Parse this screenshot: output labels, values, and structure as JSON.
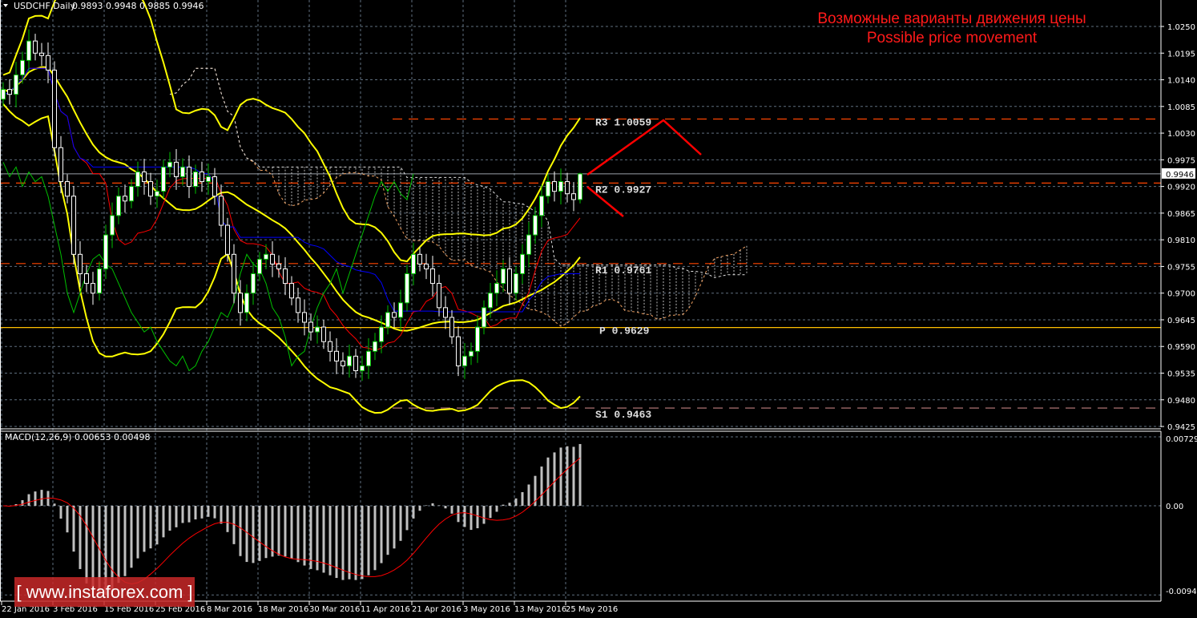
{
  "header": {
    "symbol": "USDCHF,Daily",
    "ohlc": "0.9893 0.9948 0.9885 0.9946"
  },
  "annotation": {
    "line1": "Возможные варианты движения цены",
    "line2": "Possible price movement"
  },
  "watermark": "[ www.instaforex.com ]",
  "colors": {
    "bull_border": "#00c000",
    "bear_border": "#ffffff",
    "bollinger": "#ffff00",
    "tenkan": "#ff0000",
    "kijun": "#0000ff",
    "chikou": "#00c000",
    "grid": "#5f6f7f",
    "arrow": "#ff0000"
  },
  "chart_data": [
    {
      "type": "candlestick",
      "title": "USDCHF,Daily",
      "ylim": [
        0.94,
        1.029
      ],
      "y_ticks": [
        "1.0250",
        "1.0195",
        "1.0140",
        "1.0085",
        "1.0030",
        "0.9975",
        "0.9920",
        "0.9865",
        "0.9810",
        "0.9755",
        "0.9700",
        "0.9645",
        "0.9590",
        "0.9535",
        "0.9480",
        "0.9425"
      ],
      "current_price": "0.9946",
      "x_ticks": [
        {
          "label": "22 Jan 2016",
          "bar": 0
        },
        {
          "label": "3 Feb 2016",
          "bar": 8
        },
        {
          "label": "15 Feb 2016",
          "bar": 16
        },
        {
          "label": "25 Feb 2016",
          "bar": 24
        },
        {
          "label": "8 Mar 2016",
          "bar": 32
        },
        {
          "label": "18 Mar 2016",
          "bar": 40
        },
        {
          "label": "30 Mar 2016",
          "bar": 48
        },
        {
          "label": "11 Apr 2016",
          "bar": 56
        },
        {
          "label": "21 Apr 2016",
          "bar": 64
        },
        {
          "label": "3 May 2016",
          "bar": 72
        },
        {
          "label": "13 May 2016",
          "bar": 80
        },
        {
          "label": "25 May 2016",
          "bar": 88
        }
      ],
      "close": [
        1.012,
        1.011,
        1.015,
        1.018,
        1.022,
        1.0195,
        1.019,
        1.016,
        1.0,
        0.993,
        0.99,
        0.978,
        0.974,
        0.972,
        0.97,
        0.975,
        0.982,
        0.986,
        0.99,
        0.989,
        0.992,
        0.995,
        0.993,
        0.99,
        0.991,
        0.996,
        0.997,
        0.994,
        0.996,
        0.992,
        0.995,
        0.993,
        0.994,
        0.99,
        0.984,
        0.978,
        0.97,
        0.966,
        0.97,
        0.974,
        0.977,
        0.978,
        0.976,
        0.975,
        0.972,
        0.969,
        0.966,
        0.964,
        0.962,
        0.963,
        0.96,
        0.958,
        0.956,
        0.955,
        0.957,
        0.954,
        0.955,
        0.958,
        0.96,
        0.963,
        0.966,
        0.965,
        0.968,
        0.974,
        0.978,
        0.976,
        0.975,
        0.972,
        0.967,
        0.965,
        0.961,
        0.955,
        0.957,
        0.958,
        0.963,
        0.967,
        0.97,
        0.972,
        0.975,
        0.97,
        0.974,
        0.978,
        0.982,
        0.986,
        0.99,
        0.993,
        0.991,
        0.993,
        0.9905,
        0.9893,
        0.9946
      ],
      "last_bar": {
        "open": 0.9893,
        "high": 0.9948,
        "low": 0.9885,
        "close": 0.9946
      },
      "indicators": [
        "Bollinger Bands(20,2)",
        "Ichimoku(9,26,52)"
      ],
      "pivots": [
        {
          "name": "R3",
          "label": "R3  1.0059",
          "value": 1.0059,
          "color": "#ff4500",
          "style": "dashed"
        },
        {
          "name": "R2",
          "label": "R2  0.9927",
          "value": 0.9927,
          "color": "#ff4500",
          "style": "dashed"
        },
        {
          "name": "R1",
          "label": "R1  0.9761",
          "value": 0.9761,
          "color": "#ff4500",
          "style": "dashed"
        },
        {
          "name": "P",
          "label": "P  0.9629",
          "value": 0.9629,
          "color": "#ffc000",
          "style": "solid"
        },
        {
          "name": "S1",
          "label": "S1  0.9463",
          "value": 0.9463,
          "color": "#c08080",
          "style": "dashed"
        }
      ]
    },
    {
      "type": "bar",
      "title": "MACD(12,26,9) 0.00653 0.00498",
      "ylim": [
        -0.00943,
        0.00729
      ],
      "y_ticks": [
        "0.00729",
        "0.00",
        "-0.00943"
      ],
      "macd_last": 0.00653,
      "signal_last": 0.00498
    }
  ]
}
